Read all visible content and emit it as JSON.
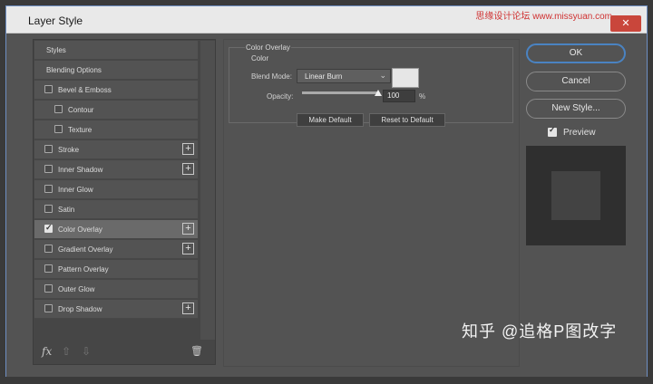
{
  "window": {
    "title": "Layer Style",
    "watermark_top": "思缘设计论坛 www.missyuan.com",
    "close_glyph": "✕"
  },
  "list": {
    "items": [
      {
        "label": "Styles",
        "checkbox": false,
        "checked": false,
        "plus": false,
        "indent": 0,
        "selected": false
      },
      {
        "label": "Blending Options",
        "checkbox": false,
        "checked": false,
        "plus": false,
        "indent": 0,
        "selected": false
      },
      {
        "label": "Bevel & Emboss",
        "checkbox": true,
        "checked": false,
        "plus": false,
        "indent": 0,
        "selected": false
      },
      {
        "label": "Contour",
        "checkbox": true,
        "checked": false,
        "plus": false,
        "indent": 1,
        "selected": false
      },
      {
        "label": "Texture",
        "checkbox": true,
        "checked": false,
        "plus": false,
        "indent": 1,
        "selected": false
      },
      {
        "label": "Stroke",
        "checkbox": true,
        "checked": false,
        "plus": true,
        "indent": 0,
        "selected": false
      },
      {
        "label": "Inner Shadow",
        "checkbox": true,
        "checked": false,
        "plus": true,
        "indent": 0,
        "selected": false
      },
      {
        "label": "Inner Glow",
        "checkbox": true,
        "checked": false,
        "plus": false,
        "indent": 0,
        "selected": false
      },
      {
        "label": "Satin",
        "checkbox": true,
        "checked": false,
        "plus": false,
        "indent": 0,
        "selected": false
      },
      {
        "label": "Color Overlay",
        "checkbox": true,
        "checked": true,
        "plus": true,
        "indent": 0,
        "selected": true
      },
      {
        "label": "Gradient Overlay",
        "checkbox": true,
        "checked": false,
        "plus": true,
        "indent": 0,
        "selected": false
      },
      {
        "label": "Pattern Overlay",
        "checkbox": true,
        "checked": false,
        "plus": false,
        "indent": 0,
        "selected": false
      },
      {
        "label": "Outer Glow",
        "checkbox": true,
        "checked": false,
        "plus": false,
        "indent": 0,
        "selected": false
      },
      {
        "label": "Drop Shadow",
        "checkbox": true,
        "checked": false,
        "plus": true,
        "indent": 0,
        "selected": false
      }
    ],
    "bottom": {
      "fx": "fx",
      "up": "⇧",
      "down": "⇩",
      "trash": "🗑"
    }
  },
  "panel": {
    "group_title": "Color Overlay",
    "sub_title": "Color",
    "blend_mode_label": "Blend Mode:",
    "blend_mode_value": "Linear Burn",
    "blend_chevron": "⌄",
    "overlay_color": "#e6e6e6",
    "opacity_label": "Opacity:",
    "opacity_value": "100",
    "opacity_level": 1.0,
    "opacity_unit": "%",
    "make_default": "Make Default",
    "reset_default": "Reset to Default"
  },
  "actions": {
    "ok": "OK",
    "cancel": "Cancel",
    "new_style": "New Style...",
    "preview_label": "Preview",
    "preview_checked": true
  },
  "watermark": "知乎 @追格P图改字"
}
